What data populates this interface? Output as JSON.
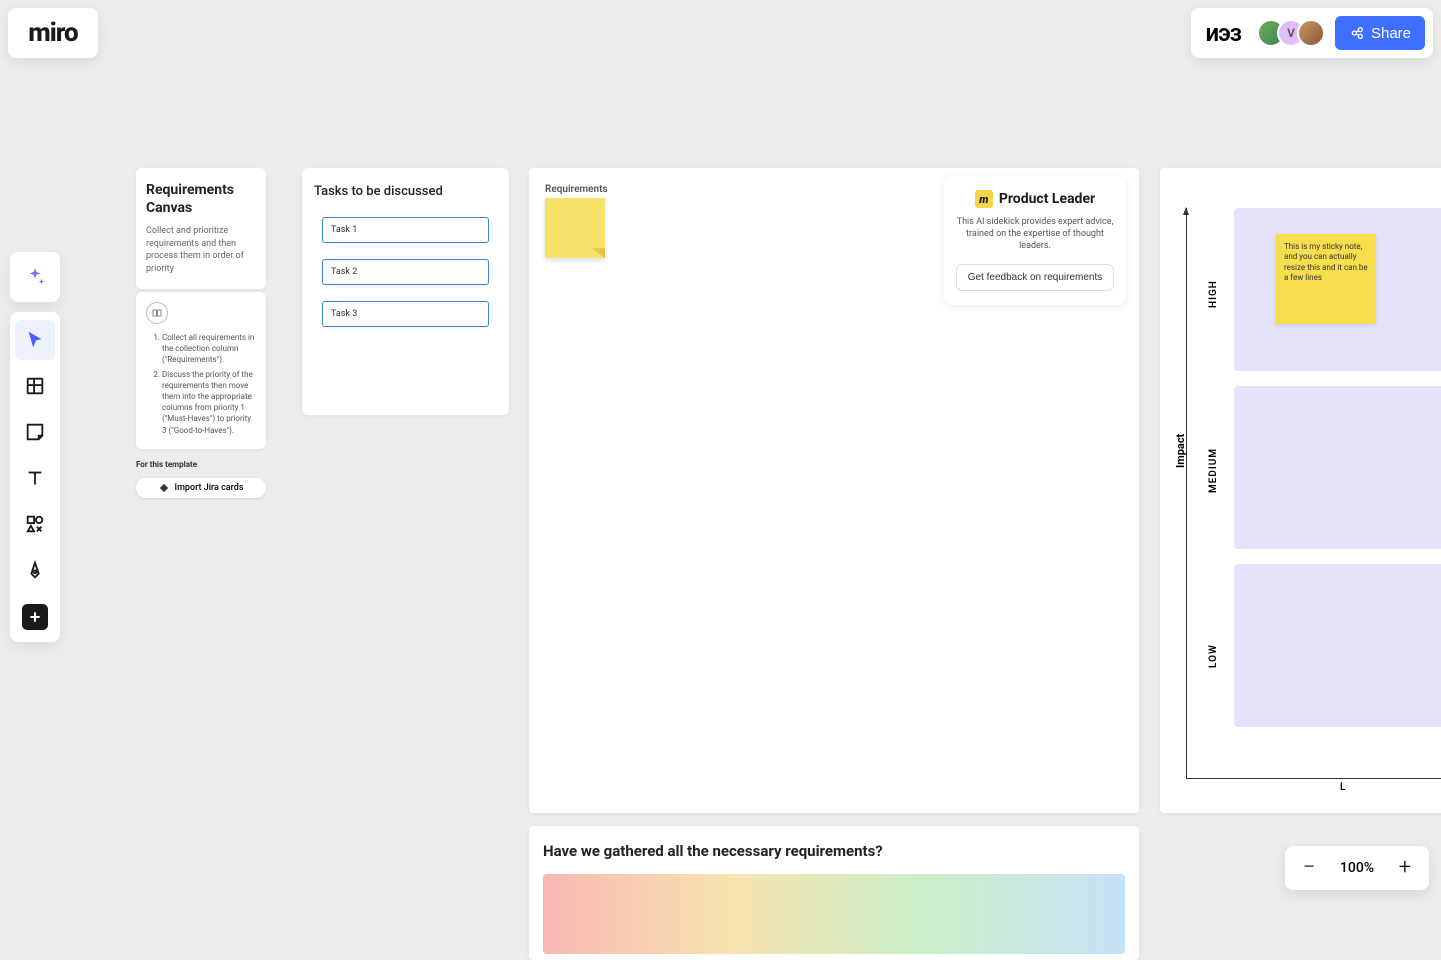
{
  "logo": "miro",
  "header": {
    "board_name": "иэз",
    "avatar_letter": "V",
    "share_label": "Share"
  },
  "canvas_panel": {
    "title": "Requirements Canvas",
    "desc": "Collect and prioritize requirements and then process them in order of priority"
  },
  "steps_panel": {
    "items": [
      "Collect all requirements in the collection column (\"Requirements\").",
      "Discuss the priority of the requirements then move them into the appropriate columns from priority 1 (\"Must-Haves\") to priority 3 (\"Good-to-Haves\")."
    ]
  },
  "template_label": "For this template",
  "import_label": "Import Jira cards",
  "tasks_panel": {
    "title": "Tasks to be discussed",
    "items": [
      "Task 1",
      "Task 2",
      "Task 3"
    ]
  },
  "req_frame": {
    "col_label": "Requirements"
  },
  "product_leader": {
    "title": "Product Leader",
    "desc": "This AI sidekick provides expert advice, trained on the expertise of thought leaders.",
    "button": "Get feedback on requirements"
  },
  "question_frame": {
    "title": "Have we gathered all the necessary requirements?"
  },
  "matrix": {
    "y_axis": "Impact",
    "high": "HIGH",
    "medium": "MEDIUM",
    "low": "LOW",
    "x_low": "L",
    "sticky_text": "This is my sticky note, and you can actually resize this and it can be a few lines"
  },
  "zoom": {
    "level": "100%"
  }
}
